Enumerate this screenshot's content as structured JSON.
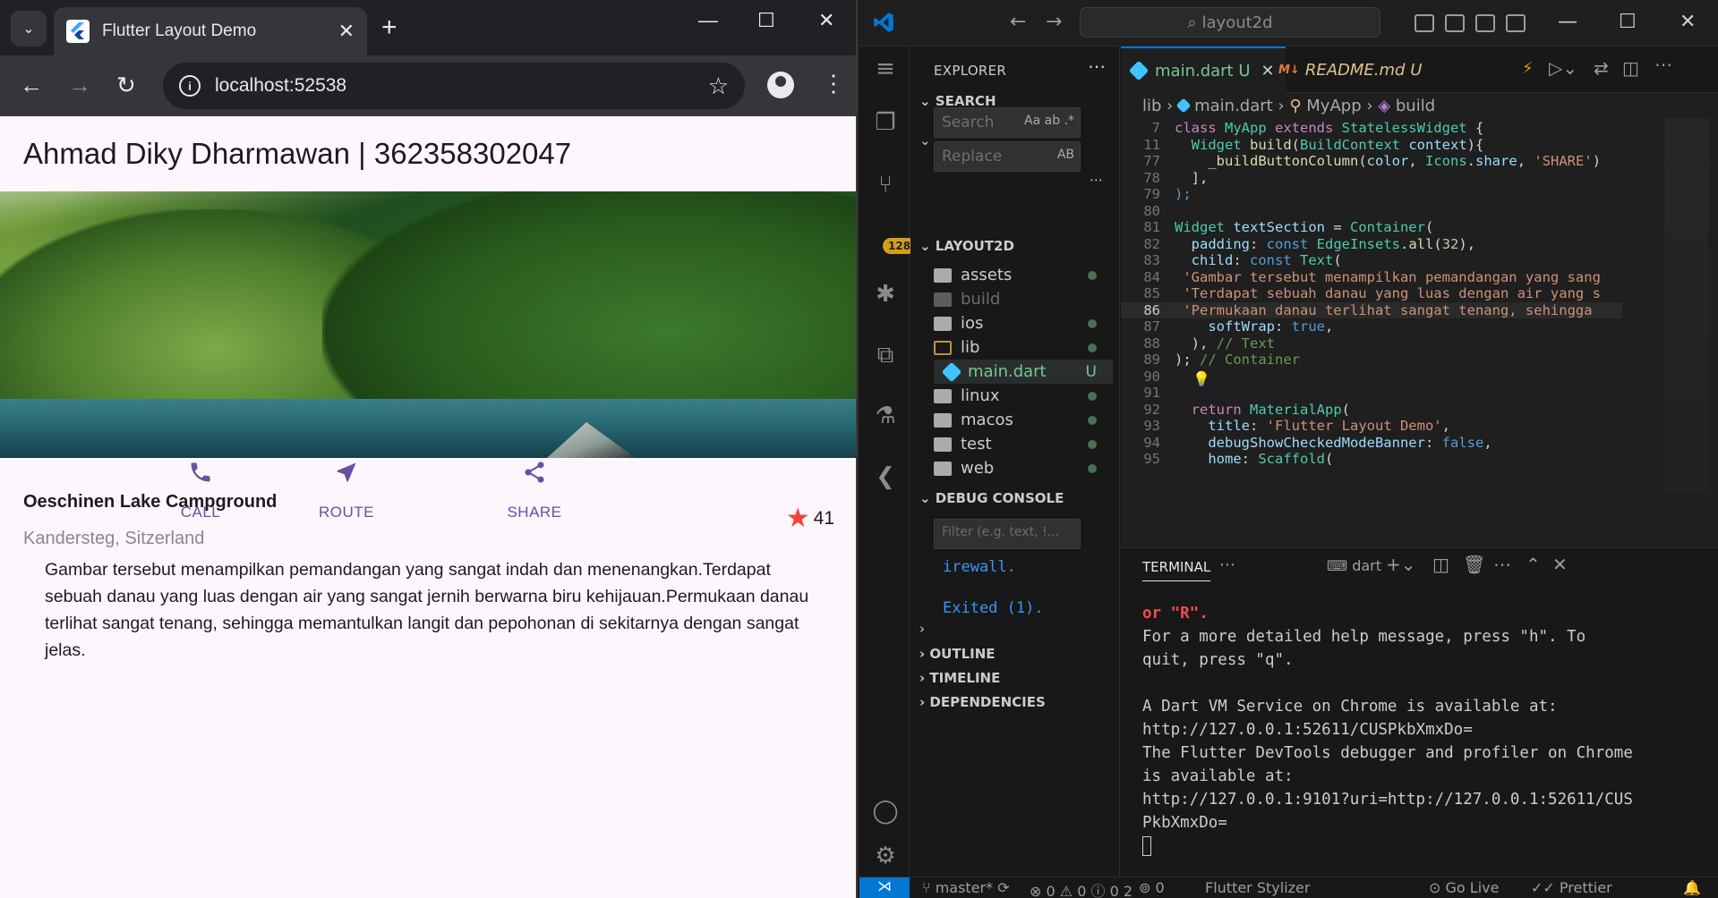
{
  "chrome": {
    "tab_title": "Flutter Layout Demo",
    "url": "localhost:52538"
  },
  "app": {
    "appbar_title": "Ahmad Diky Dharmawan | 362358302047",
    "place_name": "Oeschinen Lake Campground",
    "place_location": "Kandersteg, Sitzerland",
    "rating": "41",
    "buttons": [
      {
        "label": "CALL",
        "icon": "phone-icon"
      },
      {
        "label": "ROUTE",
        "icon": "navigation-icon"
      },
      {
        "label": "SHARE",
        "icon": "share-icon"
      }
    ],
    "description": "Gambar tersebut menampilkan pemandangan yang sangat indah dan menenangkan.Terdapat sebuah danau yang luas dengan air yang sangat jernih berwarna biru kehijauan.Permukaan danau terlihat sangat tenang, sehingga memantulkan langit dan pepohonan di sekitarnya dengan sangat jelas.",
    "accent_color": "#6750a4",
    "star_color": "#f44336"
  },
  "vscode": {
    "command_center": "layout2d",
    "explorer_title": "EXPLORER",
    "search_section": "SEARCH",
    "search_placeholder": "Search",
    "replace_placeholder": "Replace",
    "search_opts": "Aa  ab  .*",
    "replace_opt": "AB",
    "scm_badge": "128",
    "project_section": "LAYOUT2D",
    "tree": [
      {
        "name": "assets",
        "type": "folder"
      },
      {
        "name": "build",
        "type": "folder"
      },
      {
        "name": "ios",
        "type": "folder"
      },
      {
        "name": "lib",
        "type": "folder"
      },
      {
        "name": "main.dart",
        "type": "file",
        "status": "U"
      },
      {
        "name": "linux",
        "type": "folder"
      },
      {
        "name": "macos",
        "type": "folder"
      },
      {
        "name": "test",
        "type": "folder"
      },
      {
        "name": "web",
        "type": "folder"
      }
    ],
    "debug_console": "DEBUG CONSOLE",
    "filter_placeholder": "Filter (e.g. text, !...",
    "console_lines": [
      "irewall.",
      "Exited (1)."
    ],
    "outline": "OUTLINE",
    "timeline": "TIMELINE",
    "dependencies": "DEPENDENCIES",
    "tabs": [
      {
        "label": "main.dart",
        "status": "U"
      },
      {
        "label": "README.md",
        "status": "U"
      }
    ],
    "breadcrumb": [
      "lib",
      "main.dart",
      "MyApp",
      "build"
    ],
    "sticky": [
      {
        "ln": "7",
        "code": "class MyApp extends StatelessWidget {"
      },
      {
        "ln": "11",
        "code": "  Widget build(BuildContext context){"
      }
    ],
    "code_lines": [
      {
        "ln": "77",
        "code": "    _buildButtonColumn(color, Icons.share, 'SHARE')"
      },
      {
        "ln": "78",
        "code": "  ],"
      },
      {
        "ln": "79",
        "code": ");"
      },
      {
        "ln": "80",
        "code": ""
      },
      {
        "ln": "81",
        "code": "Widget textSection = Container("
      },
      {
        "ln": "82",
        "code": "  padding: const EdgeInsets.all(32),"
      },
      {
        "ln": "83",
        "code": "  child: const Text("
      },
      {
        "ln": "84",
        "code": " 'Gambar tersebut menampilkan pemandangan yang sang"
      },
      {
        "ln": "85",
        "code": " 'Terdapat sebuah danau yang luas dengan air yang s"
      },
      {
        "ln": "86",
        "code": " 'Permukaan danau terlihat sangat tenang, sehingga"
      },
      {
        "ln": "87",
        "code": "    softWrap: true,"
      },
      {
        "ln": "88",
        "code": "  ), // Text"
      },
      {
        "ln": "89",
        "code": "); // Container"
      },
      {
        "ln": "90",
        "code": ""
      },
      {
        "ln": "91",
        "code": ""
      },
      {
        "ln": "92",
        "code": "  return MaterialApp("
      },
      {
        "ln": "93",
        "code": "    title: 'Flutter Layout Demo',"
      },
      {
        "ln": "94",
        "code": "    debugShowCheckedModeBanner: false,"
      },
      {
        "ln": "95",
        "code": "    home: Scaffold("
      }
    ],
    "terminal_tab": "TERMINAL",
    "terminal_shell": "dart",
    "terminal_lines": [
      "or \"R\".",
      "For a more detailed help message, press \"h\". To",
      "quit, press \"q\".",
      "",
      "A Dart VM Service on Chrome is available at:",
      "http://127.0.0.1:52611/CUSPkbXmxDo=",
      "The Flutter DevTools debugger and profiler on Chrome",
      "is available at:",
      "http://127.0.0.1:9101?uri=http://127.0.0.1:52611/CUS",
      "PkbXmxDo="
    ],
    "status": {
      "branch": "master*",
      "errors": "0",
      "warnings": "0",
      "info": "0",
      "info2": "2",
      "ports": "0",
      "flutter_stylizer": "Flutter Stylizer",
      "go_live": "Go Live",
      "prettier": "Prettier"
    }
  }
}
